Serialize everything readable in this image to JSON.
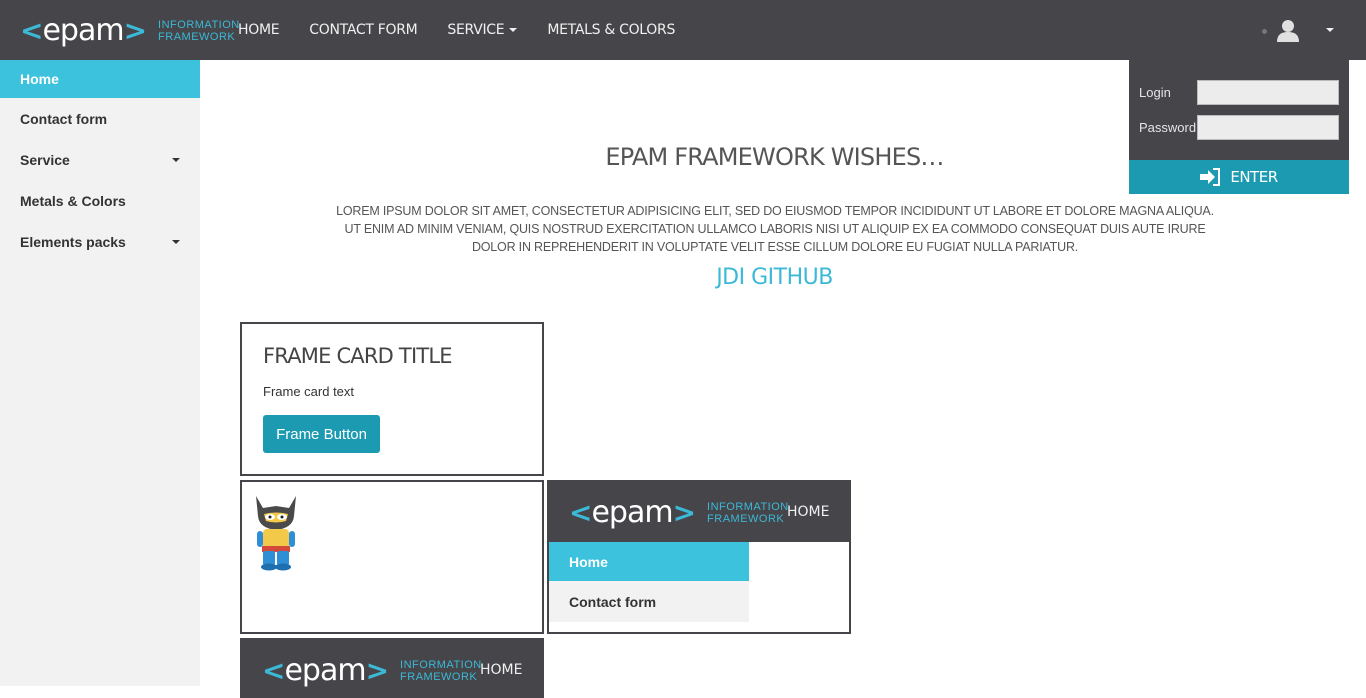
{
  "header": {
    "logo_word": "epam",
    "logo_sub_line1": "INFORMATION",
    "logo_sub_line2": "FRAMEWORK",
    "nav": [
      {
        "label": "HOME"
      },
      {
        "label": "CONTACT FORM"
      },
      {
        "label": "SERVICE"
      },
      {
        "label": "METALS & COLORS"
      }
    ]
  },
  "sidebar": {
    "items": [
      {
        "label": "Home",
        "active": true
      },
      {
        "label": "Contact form"
      },
      {
        "label": "Service",
        "has_submenu": true
      },
      {
        "label": "Metals & Colors"
      },
      {
        "label": "Elements packs",
        "has_submenu": true
      }
    ]
  },
  "login": {
    "login_label": "Login",
    "password_label": "Password",
    "login_value": "",
    "password_value": "",
    "enter_label": "ENTER",
    "enter_icon": "sign-in-icon"
  },
  "main": {
    "title": "EPAM FRAMEWORK WISHES…",
    "text": "LOREM IPSUM DOLOR SIT AMET, CONSECTETUR ADIPISICING ELIT, SED DO EIUSMOD TEMPOR INCIDIDUNT UT LABORE ET DOLORE MAGNA ALIQUA. UT ENIM AD MINIM VENIAM, QUIS NOSTRUD EXERCITATION ULLAMCO LABORIS NISI UT ALIQUIP EX EA COMMODO CONSEQUAT DUIS AUTE IRURE DOLOR IN REPREHENDERIT IN VOLUPTATE VELIT ESSE CILLUM DOLORE EU FUGIAT NULLA PARIATUR.",
    "github_link": "JDI GITHUB"
  },
  "frame_card": {
    "title": "FRAME CARD TITLE",
    "text": "Frame card text",
    "button": "Frame Button"
  },
  "frame_mini_site": {
    "home": "HOME",
    "menu": [
      {
        "label": "Home",
        "active": true
      },
      {
        "label": "Contact form"
      }
    ]
  },
  "frame_bottom": {
    "home": "HOME"
  },
  "colors": {
    "header_bg": "#45454a",
    "accent": "#3cc2dd",
    "button": "#1b9ab2",
    "sidebar_bg": "#f2f2f2"
  }
}
